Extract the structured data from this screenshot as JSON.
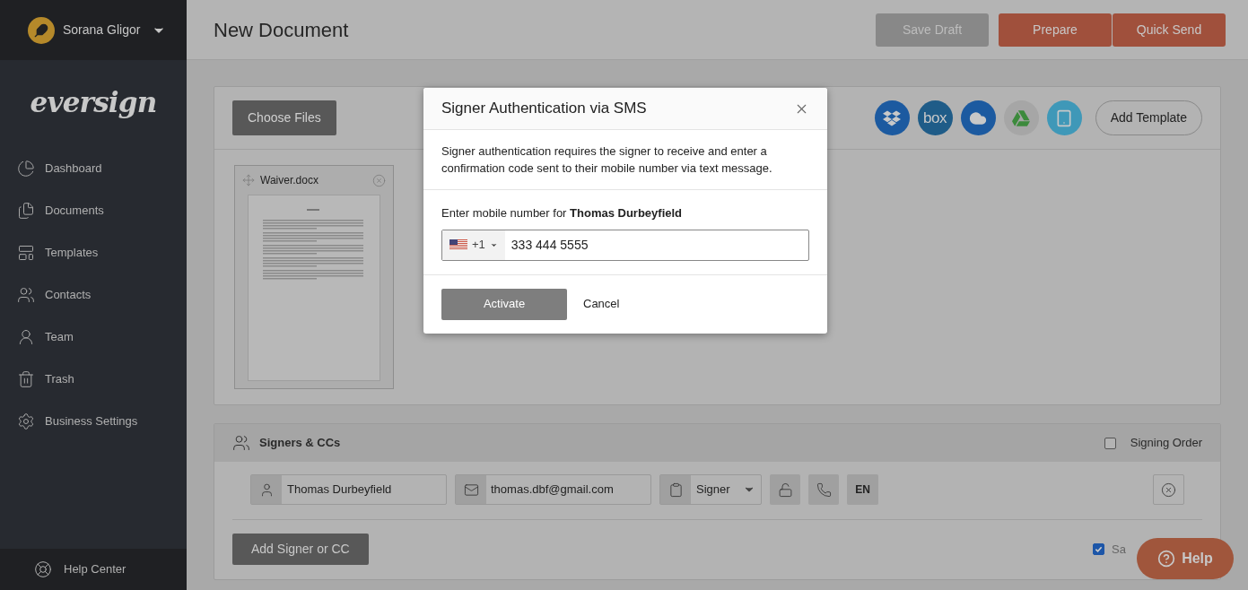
{
  "user": {
    "name": "Sorana Gligor"
  },
  "logo": "eversign",
  "sidebar": {
    "items": [
      {
        "label": "Dashboard",
        "selected": false
      },
      {
        "label": "Documents",
        "selected": false
      },
      {
        "label": "Templates",
        "selected": false
      },
      {
        "label": "Contacts",
        "selected": false
      },
      {
        "label": "Team",
        "selected": false
      },
      {
        "label": "Trash",
        "selected": false
      },
      {
        "label": "Business Settings",
        "selected": false
      }
    ],
    "footer": "Help Center"
  },
  "header": {
    "title": "New Document",
    "buttons": [
      {
        "label": "Save Draft",
        "kind": "secondary"
      },
      {
        "label": "Prepare",
        "kind": "primary"
      },
      {
        "label": "Quick Send",
        "kind": "primary"
      }
    ]
  },
  "files": {
    "choose_button": "Choose Files",
    "sources": [
      {
        "kind": "dropbox"
      },
      {
        "kind": "box",
        "label": "box"
      },
      {
        "kind": "onedrive"
      },
      {
        "kind": "drive"
      },
      {
        "kind": "device"
      }
    ],
    "add_template": "Add Template",
    "documents": [
      {
        "name": "Waiver.docx"
      }
    ]
  },
  "signers": {
    "title": "Signers & CCs",
    "signing_order": {
      "label": "Signing Order",
      "checked": false
    },
    "rows": [
      {
        "name": "Thomas Durbeyfield",
        "email": "thomas.dbf@gmail.com",
        "role": "Signer",
        "language": "EN"
      }
    ],
    "add_button": "Add Signer or CC",
    "option": {
      "label": "Sa",
      "checked": true
    }
  },
  "help_button": "Help",
  "modal": {
    "title": "Signer Authentication via SMS",
    "description": "Signer authentication requires the signer to receive and enter a confirmation code sent to their mobile number via text message.",
    "prompt": "Enter mobile number for **Thomas Durbeyfield**",
    "country_code": "+1",
    "phone": "333 444 5555",
    "buttons": [
      {
        "label": "Activate",
        "kind": "primary"
      },
      {
        "label": "Cancel",
        "kind": "link"
      }
    ]
  }
}
